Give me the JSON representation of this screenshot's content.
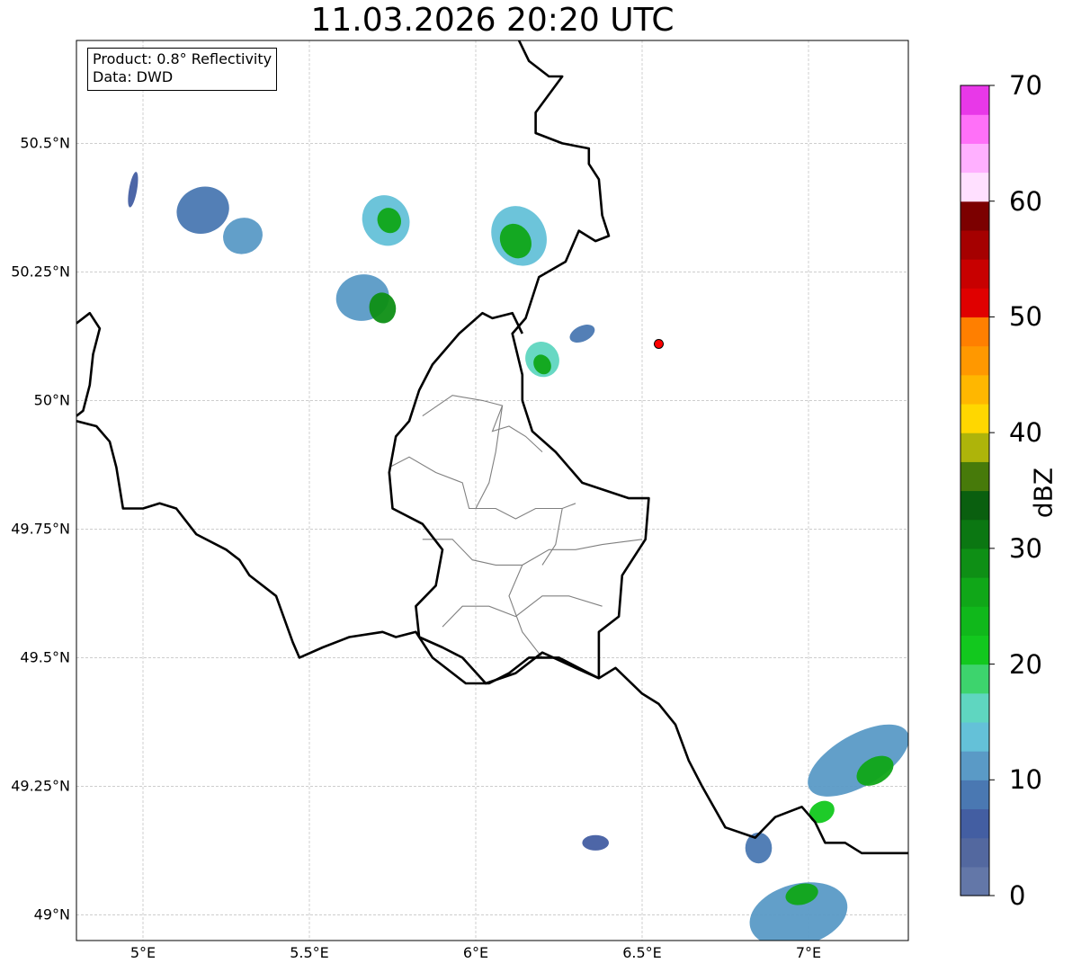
{
  "title": "11.03.2026 20:20 UTC",
  "info": {
    "product": "Product: 0.8° Reflectivity",
    "source": "Data: DWD"
  },
  "map_extent": {
    "lon_min": 4.8,
    "lon_max": 7.3,
    "lat_min": 48.95,
    "lat_max": 50.7
  },
  "lat_ticks": [
    {
      "value": 50.5,
      "label": "50.5°N"
    },
    {
      "value": 50.25,
      "label": "50.25°N"
    },
    {
      "value": 50.0,
      "label": "50°N"
    },
    {
      "value": 49.75,
      "label": "49.75°N"
    },
    {
      "value": 49.5,
      "label": "49.5°N"
    },
    {
      "value": 49.25,
      "label": "49.25°N"
    },
    {
      "value": 49.0,
      "label": "49°N"
    }
  ],
  "lon_ticks": [
    {
      "value": 5.0,
      "label": "5°E"
    },
    {
      "value": 5.5,
      "label": "5.5°E"
    },
    {
      "value": 6.0,
      "label": "6°E"
    },
    {
      "value": 6.5,
      "label": "6.5°E"
    },
    {
      "value": 7.0,
      "label": "7°E"
    }
  ],
  "marker": {
    "lon": 6.55,
    "lat": 50.11,
    "color": "#ff0000"
  },
  "colorbar": {
    "label": "dBZ",
    "min": 0,
    "max": 70,
    "ticks": [
      {
        "value": 0,
        "label": "0"
      },
      {
        "value": 10,
        "label": "10"
      },
      {
        "value": 20,
        "label": "20"
      },
      {
        "value": 30,
        "label": "30"
      },
      {
        "value": 40,
        "label": "40"
      },
      {
        "value": 50,
        "label": "50"
      },
      {
        "value": 60,
        "label": "60"
      },
      {
        "value": 70,
        "label": "70"
      }
    ],
    "colors": [
      "#6377a8",
      "#53689f",
      "#435ea2",
      "#4a78b2",
      "#5a9ac6",
      "#64c1d8",
      "#5fd6c0",
      "#3dd46d",
      "#12c81e",
      "#10b81b",
      "#10a718",
      "#0e8f15",
      "#0b7712",
      "#0a5f0f",
      "#477a0a",
      "#aeb40a",
      "#ffd700",
      "#ffb700",
      "#ff9800",
      "#ff7f00",
      "#e00000",
      "#c80000",
      "#a50000",
      "#7c0000",
      "#ffe0ff",
      "#ffb0ff",
      "#ff70f8",
      "#e838e8"
    ]
  },
  "borders": {
    "national": [
      [
        [
          4.8,
          50.15
        ],
        [
          4.84,
          50.17
        ],
        [
          4.87,
          50.14
        ],
        [
          4.85,
          50.09
        ],
        [
          4.84,
          50.03
        ],
        [
          4.82,
          49.98
        ],
        [
          4.8,
          49.97
        ]
      ],
      [
        [
          4.8,
          49.96
        ],
        [
          4.86,
          49.95
        ],
        [
          4.9,
          49.92
        ],
        [
          4.92,
          49.87
        ],
        [
          4.94,
          49.79
        ],
        [
          5.0,
          49.79
        ],
        [
          5.05,
          49.8
        ],
        [
          5.1,
          49.79
        ],
        [
          5.16,
          49.74
        ],
        [
          5.25,
          49.71
        ],
        [
          5.29,
          49.69
        ],
        [
          5.32,
          49.66
        ],
        [
          5.4,
          49.62
        ],
        [
          5.45,
          49.53
        ],
        [
          5.47,
          49.5
        ],
        [
          5.54,
          49.52
        ],
        [
          5.62,
          49.54
        ],
        [
          5.72,
          49.55
        ],
        [
          5.76,
          49.54
        ],
        [
          5.82,
          49.55
        ],
        [
          5.87,
          49.5
        ],
        [
          5.97,
          49.45
        ],
        [
          6.04,
          49.45
        ],
        [
          6.1,
          49.47
        ],
        [
          6.16,
          49.5
        ],
        [
          6.25,
          49.5
        ],
        [
          6.34,
          49.47
        ],
        [
          6.37,
          49.46
        ],
        [
          6.42,
          49.48
        ],
        [
          6.5,
          49.43
        ],
        [
          6.55,
          49.41
        ],
        [
          6.6,
          49.37
        ],
        [
          6.64,
          49.3
        ],
        [
          6.68,
          49.25
        ],
        [
          6.75,
          49.17
        ],
        [
          6.84,
          49.15
        ],
        [
          6.9,
          49.19
        ],
        [
          6.98,
          49.21
        ],
        [
          7.02,
          49.18
        ],
        [
          7.05,
          49.14
        ],
        [
          7.11,
          49.14
        ],
        [
          7.16,
          49.12
        ],
        [
          7.22,
          49.12
        ],
        [
          7.3,
          49.12
        ]
      ],
      [
        [
          6.13,
          50.7
        ],
        [
          6.16,
          50.66
        ],
        [
          6.22,
          50.63
        ],
        [
          6.26,
          50.63
        ],
        [
          6.18,
          50.56
        ],
        [
          6.18,
          50.52
        ],
        [
          6.26,
          50.5
        ],
        [
          6.34,
          50.49
        ],
        [
          6.34,
          50.46
        ],
        [
          6.37,
          50.43
        ],
        [
          6.38,
          50.36
        ],
        [
          6.4,
          50.32
        ],
        [
          6.36,
          50.31
        ],
        [
          6.31,
          50.33
        ],
        [
          6.27,
          50.27
        ],
        [
          6.19,
          50.24
        ],
        [
          6.15,
          50.16
        ],
        [
          6.11,
          50.13
        ],
        [
          6.14,
          50.05
        ],
        [
          6.14,
          50.0
        ],
        [
          6.17,
          49.94
        ],
        [
          6.24,
          49.9
        ],
        [
          6.32,
          49.84
        ],
        [
          6.46,
          49.81
        ],
        [
          6.52,
          49.81
        ],
        [
          6.51,
          49.73
        ],
        [
          6.44,
          49.66
        ],
        [
          6.43,
          49.58
        ],
        [
          6.37,
          49.55
        ],
        [
          6.37,
          49.46
        ]
      ],
      [
        [
          6.37,
          49.46
        ],
        [
          6.3,
          49.48
        ],
        [
          6.2,
          49.51
        ],
        [
          6.12,
          49.47
        ],
        [
          6.03,
          49.45
        ],
        [
          5.96,
          49.5
        ],
        [
          5.9,
          49.52
        ],
        [
          5.83,
          49.54
        ],
        [
          5.82,
          49.6
        ],
        [
          5.88,
          49.64
        ],
        [
          5.9,
          49.71
        ],
        [
          5.84,
          49.76
        ],
        [
          5.75,
          49.79
        ],
        [
          5.74,
          49.86
        ],
        [
          5.76,
          49.93
        ],
        [
          5.8,
          49.96
        ],
        [
          5.83,
          50.02
        ],
        [
          5.87,
          50.07
        ],
        [
          5.95,
          50.13
        ],
        [
          6.02,
          50.17
        ],
        [
          6.05,
          50.16
        ],
        [
          6.11,
          50.17
        ],
        [
          6.14,
          50.13
        ]
      ]
    ],
    "internal": [
      [
        [
          5.84,
          49.97
        ],
        [
          5.93,
          50.01
        ],
        [
          6.02,
          50.0
        ],
        [
          6.08,
          49.99
        ],
        [
          6.05,
          49.94
        ],
        [
          6.1,
          49.95
        ],
        [
          6.15,
          49.93
        ],
        [
          6.2,
          49.9
        ]
      ],
      [
        [
          5.74,
          49.87
        ],
        [
          5.8,
          49.89
        ],
        [
          5.88,
          49.86
        ],
        [
          5.96,
          49.84
        ],
        [
          5.98,
          49.79
        ],
        [
          6.06,
          49.79
        ],
        [
          6.12,
          49.77
        ],
        [
          6.18,
          49.79
        ],
        [
          6.26,
          49.79
        ],
        [
          6.3,
          49.8
        ]
      ],
      [
        [
          5.84,
          49.73
        ],
        [
          5.93,
          49.73
        ],
        [
          5.99,
          49.69
        ],
        [
          6.06,
          49.68
        ],
        [
          6.14,
          49.68
        ],
        [
          6.22,
          49.71
        ],
        [
          6.3,
          49.71
        ],
        [
          6.38,
          49.72
        ],
        [
          6.5,
          49.73
        ]
      ],
      [
        [
          5.9,
          49.56
        ],
        [
          5.96,
          49.6
        ],
        [
          6.04,
          49.6
        ],
        [
          6.12,
          49.58
        ],
        [
          6.2,
          49.62
        ],
        [
          6.28,
          49.62
        ],
        [
          6.38,
          49.6
        ]
      ],
      [
        [
          6.14,
          49.68
        ],
        [
          6.1,
          49.62
        ],
        [
          6.14,
          49.55
        ],
        [
          6.2,
          49.5
        ]
      ],
      [
        [
          6.08,
          49.99
        ],
        [
          6.06,
          49.9
        ],
        [
          6.04,
          49.84
        ],
        [
          6.0,
          49.79
        ]
      ],
      [
        [
          6.26,
          49.79
        ],
        [
          6.24,
          49.72
        ],
        [
          6.2,
          49.68
        ]
      ]
    ]
  },
  "radar_cells": [
    {
      "lon": 5.18,
      "lat": 50.37,
      "rx": 0.08,
      "ry": 0.045,
      "rot": -20,
      "dbz": 8
    },
    {
      "lon": 5.3,
      "lat": 50.32,
      "rx": 0.06,
      "ry": 0.035,
      "rot": -20,
      "dbz": 12
    },
    {
      "lon": 4.97,
      "lat": 50.41,
      "rx": 0.012,
      "ry": 0.035,
      "rot": 10,
      "dbz": 6
    },
    {
      "lon": 5.73,
      "lat": 50.35,
      "rx": 0.07,
      "ry": 0.05,
      "rot": -25,
      "dbz": 14
    },
    {
      "lon": 5.74,
      "lat": 50.35,
      "rx": 0.035,
      "ry": 0.025,
      "rot": -25,
      "dbz": 26
    },
    {
      "lon": 5.66,
      "lat": 50.2,
      "rx": 0.08,
      "ry": 0.045,
      "rot": -10,
      "dbz": 12
    },
    {
      "lon": 5.72,
      "lat": 50.18,
      "rx": 0.04,
      "ry": 0.03,
      "rot": -10,
      "dbz": 28
    },
    {
      "lon": 6.13,
      "lat": 50.32,
      "rx": 0.08,
      "ry": 0.06,
      "rot": -30,
      "dbz": 14
    },
    {
      "lon": 6.12,
      "lat": 50.31,
      "rx": 0.045,
      "ry": 0.035,
      "rot": -30,
      "dbz": 27
    },
    {
      "lon": 6.2,
      "lat": 50.08,
      "rx": 0.05,
      "ry": 0.035,
      "rot": -30,
      "dbz": 16
    },
    {
      "lon": 6.2,
      "lat": 50.07,
      "rx": 0.025,
      "ry": 0.02,
      "rot": -30,
      "dbz": 26
    },
    {
      "lon": 6.32,
      "lat": 50.13,
      "rx": 0.04,
      "ry": 0.015,
      "rot": -25,
      "dbz": 8
    },
    {
      "lon": 6.36,
      "lat": 49.14,
      "rx": 0.04,
      "ry": 0.015,
      "rot": 0,
      "dbz": 7
    },
    {
      "lon": 7.15,
      "lat": 49.3,
      "rx": 0.17,
      "ry": 0.05,
      "rot": -30,
      "dbz": 12
    },
    {
      "lon": 7.2,
      "lat": 49.28,
      "rx": 0.06,
      "ry": 0.025,
      "rot": -30,
      "dbz": 26
    },
    {
      "lon": 7.04,
      "lat": 49.2,
      "rx": 0.04,
      "ry": 0.02,
      "rot": -30,
      "dbz": 22
    },
    {
      "lon": 6.97,
      "lat": 49.0,
      "rx": 0.15,
      "ry": 0.06,
      "rot": -15,
      "dbz": 10
    },
    {
      "lon": 6.98,
      "lat": 49.04,
      "rx": 0.05,
      "ry": 0.02,
      "rot": -15,
      "dbz": 25
    },
    {
      "lon": 6.85,
      "lat": 49.13,
      "rx": 0.04,
      "ry": 0.03,
      "rot": 0,
      "dbz": 8
    }
  ]
}
